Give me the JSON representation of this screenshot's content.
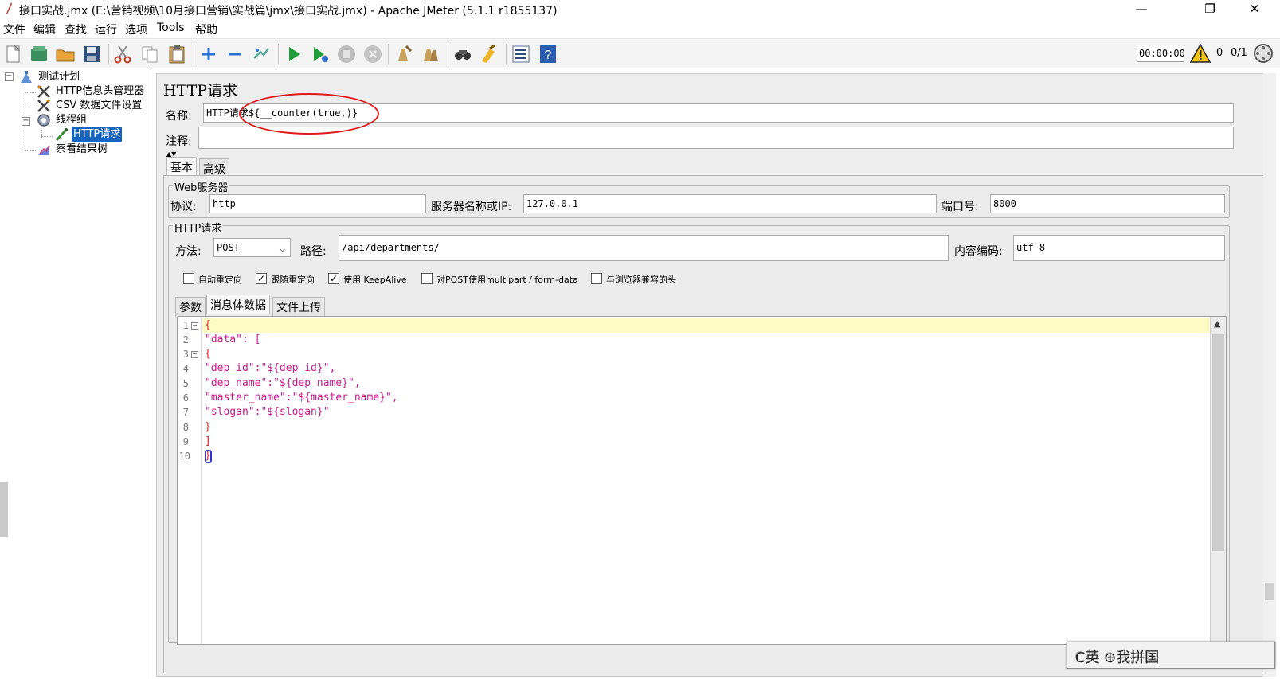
{
  "window": {
    "title": "接口实战.jmx (E:\\营销视频\\10月接口营销\\实战篇\\jmx\\接口实战.jmx) - Apache JMeter (5.1.1 r1855137)",
    "controls": {
      "minimize": "—",
      "maximize": "❐",
      "close": "✕"
    }
  },
  "menu": [
    "文件",
    "编辑",
    "查找",
    "运行",
    "选项",
    "Tools",
    "帮助"
  ],
  "toolbar": {
    "icons": [
      "new-icon",
      "templates-icon",
      "open-icon",
      "save-icon",
      "cut-icon",
      "copy-icon",
      "paste-icon",
      "expand-icon",
      "collapse-icon",
      "toggle-icon",
      "start-icon",
      "start-no-pause-icon",
      "stop-icon",
      "shutdown-icon",
      "clear-icon",
      "clear-all-icon",
      "search-icon",
      "reset-search-icon",
      "function-helper-icon",
      "help-icon"
    ],
    "timer": "00:00:00",
    "warning_count": "0",
    "threads": "0/1"
  },
  "tree": [
    {
      "label": "测试计划",
      "icon": "test-plan-icon",
      "level": 0,
      "selected": false
    },
    {
      "label": "HTTP信息头管理器",
      "icon": "header-manager-icon",
      "level": 1,
      "selected": false
    },
    {
      "label": "CSV 数据文件设置",
      "icon": "csv-config-icon",
      "level": 1,
      "selected": false
    },
    {
      "label": "线程组",
      "icon": "thread-group-icon",
      "level": 1,
      "selected": false
    },
    {
      "label": "HTTP请求",
      "icon": "http-sampler-icon",
      "level": 2,
      "selected": true
    },
    {
      "label": "察看结果树",
      "icon": "results-tree-icon",
      "level": 1,
      "selected": false
    }
  ],
  "panel": {
    "title": "HTTP请求",
    "name_label": "名称:",
    "name_value": "HTTP请求${__counter(true,)}",
    "comment_label": "注释:",
    "comment_value": "",
    "tabs": [
      "基本",
      "高级"
    ],
    "active_tab": "基本"
  },
  "web_server": {
    "group_title": "Web服务器",
    "protocol_label": "协议:",
    "protocol": "http",
    "server_label": "服务器名称或IP:",
    "server": "127.0.0.1",
    "port_label": "端口号:",
    "port": "8000"
  },
  "http_request": {
    "group_title": "HTTP请求",
    "method_label": "方法:",
    "method": "POST",
    "path_label": "路径:",
    "path": "/api/departments/",
    "encoding_label": "内容编码:",
    "encoding": "utf-8",
    "checkboxes": [
      {
        "label": "自动重定向",
        "checked": false
      },
      {
        "label": "跟随重定向",
        "checked": true
      },
      {
        "label": "使用 KeepAlive",
        "checked": true
      },
      {
        "label": "对POST使用multipart / form-data",
        "checked": false
      },
      {
        "label": "与浏览器兼容的头",
        "checked": false
      }
    ],
    "sub_tabs": [
      "参数",
      "消息体数据",
      "文件上传"
    ],
    "active_sub_tab": "消息体数据"
  },
  "body_lines": [
    "{",
    "\"data\": [",
    "{",
    "\"dep_id\":\"${dep_id}\",",
    "\"dep_name\":\"${dep_name}\",",
    "\"master_name\":\"${master_name}\",",
    "\"slogan\":\"${slogan}\"",
    "}",
    "]",
    "}"
  ],
  "line_numbers": [
    "1",
    "2",
    "3",
    "4",
    "5",
    "6",
    "7",
    "8",
    "9",
    "10"
  ],
  "ime_overlay": "C英 ⊕我拼国"
}
